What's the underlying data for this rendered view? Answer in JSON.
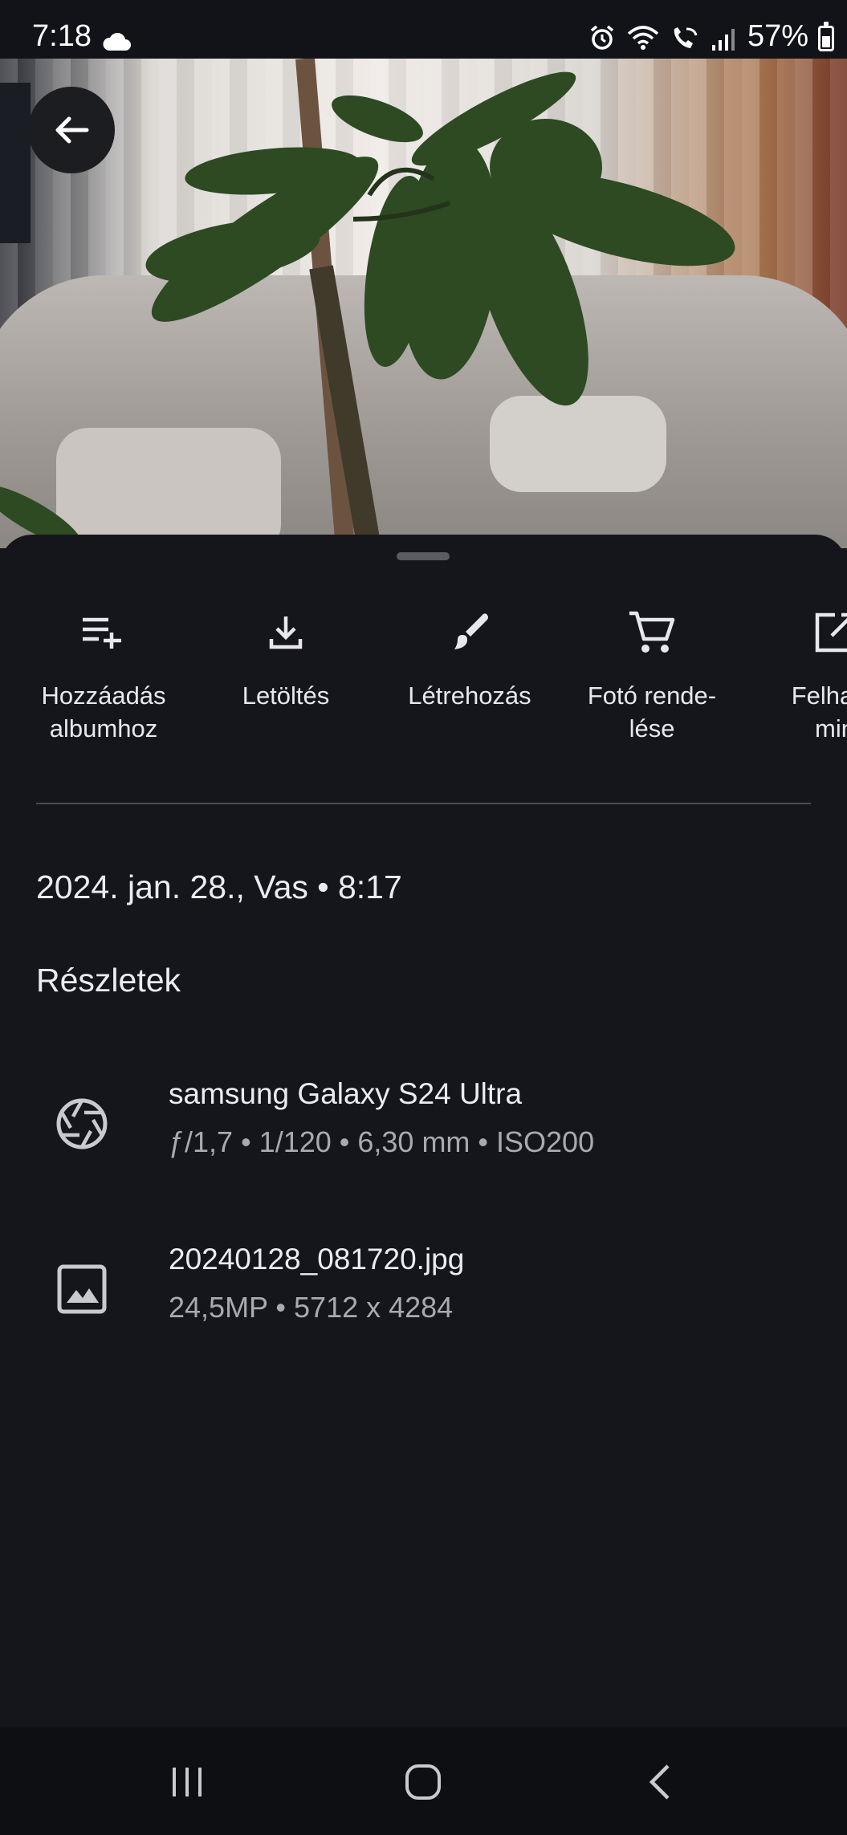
{
  "status_bar": {
    "time": "7:18",
    "battery": "57%",
    "icons": [
      "cloud-icon",
      "alarm-icon",
      "wifi-icon",
      "wifi-calling-icon",
      "signal-icon",
      "battery-icon"
    ]
  },
  "photo": {
    "description_icon": "photo-preview"
  },
  "actions": [
    {
      "label": "Hozzáadás\nalbumhoz",
      "icon": "playlist-add-icon"
    },
    {
      "label": "Letöltés",
      "icon": "download-icon"
    },
    {
      "label": "Létrehozás",
      "icon": "brush-icon"
    },
    {
      "label": "Fotó rende-\nlése",
      "icon": "cart-icon"
    },
    {
      "label": "Felhasz\nmin",
      "icon": "open-external-icon"
    }
  ],
  "date_time": "2024. jan. 28., Vas  •  8:17",
  "details_heading": "Részletek",
  "details": {
    "camera": {
      "title": "samsung Galaxy S24 Ultra",
      "sub": "ƒ/1,7  •  1/120  •  6,30 mm  •  ISO200",
      "icon": "camera-aperture-icon"
    },
    "file": {
      "title": "20240128_081720.jpg",
      "sub": "24,5MP  •  5712 x 4284",
      "icon": "image-icon"
    }
  },
  "nav": {
    "icons": [
      "recents-icon",
      "home-icon",
      "back-icon"
    ]
  }
}
